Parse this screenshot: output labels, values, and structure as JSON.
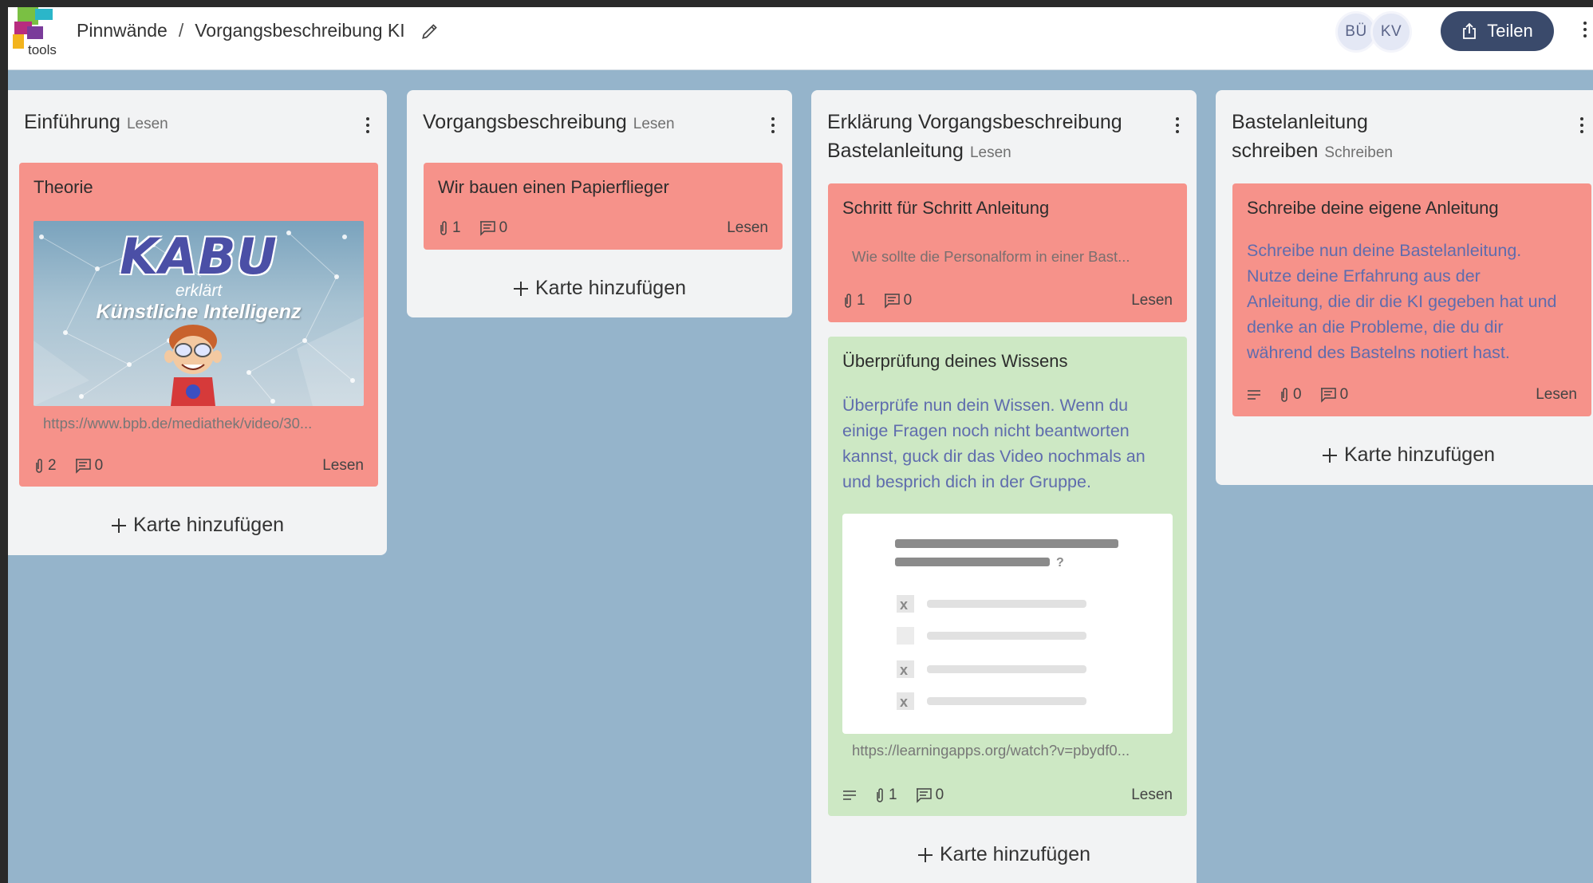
{
  "breadcrumb": {
    "root": "Pinnwände",
    "separator": "/",
    "board": "Vorgangsbeschreibung KI"
  },
  "logo": {
    "text": "tools"
  },
  "avatars": [
    "BÜ",
    "KV"
  ],
  "share": {
    "label": "Teilen"
  },
  "add_card_label": "Karte hinzufügen",
  "columns": [
    {
      "title": "Einführung",
      "mode": "Lesen",
      "cards": [
        {
          "title": "Theorie",
          "color": "#f6928a",
          "image": {
            "heading": "KABU",
            "sub": "erklärt",
            "caption": "Künstliche Intelligenz"
          },
          "link": "https://www.bpb.de/mediathek/video/30...",
          "attachments": "2",
          "comments": "0",
          "read": "Lesen"
        }
      ]
    },
    {
      "title": "Vorgangsbeschreibung",
      "mode": "Lesen",
      "cards": [
        {
          "title": "Wir bauen einen Papierflieger",
          "color": "#f6928a",
          "attachments": "1",
          "comments": "0",
          "read": "Lesen"
        }
      ]
    },
    {
      "title_line1": "Erklärung Vorgangsbeschreibung",
      "title_line2": "Bastelanleitung",
      "mode": "Lesen",
      "cards": [
        {
          "title": "Schritt für Schritt Anleitung",
          "color": "#f6928a",
          "snippet": "Wie sollte die Personalform in einer Bast...",
          "attachments": "1",
          "comments": "0",
          "read": "Lesen"
        },
        {
          "title": "Überprüfung deines Wissens",
          "color": "#cde8c4",
          "text": [
            "Überprüfe nun dein Wissen. Wenn du",
            "einige Fragen noch nicht beantworten",
            "kannst, guck dir das Video nochmals an",
            "und besprich dich in der Gruppe."
          ],
          "link": "https://learningapps.org/watch?v=pbydf0...",
          "attachments": "1",
          "comments": "0",
          "read": "Lesen"
        }
      ]
    },
    {
      "title_line1": "Bastelanleitung",
      "title_line2": "schreiben",
      "mode": "Schreiben",
      "cards": [
        {
          "title": "Schreibe deine eigene Anleitung",
          "color": "#f6928a",
          "text": [
            "Schreibe nun deine Bastelanleitung.",
            "Nutze deine Erfahrung aus der",
            "Anleitung, die dir die KI gegeben hat und",
            "denke an die Probleme, die du dir",
            "während des Bastelns notiert hast."
          ],
          "attachments": "0",
          "comments": "0",
          "read": "Lesen"
        }
      ]
    }
  ]
}
